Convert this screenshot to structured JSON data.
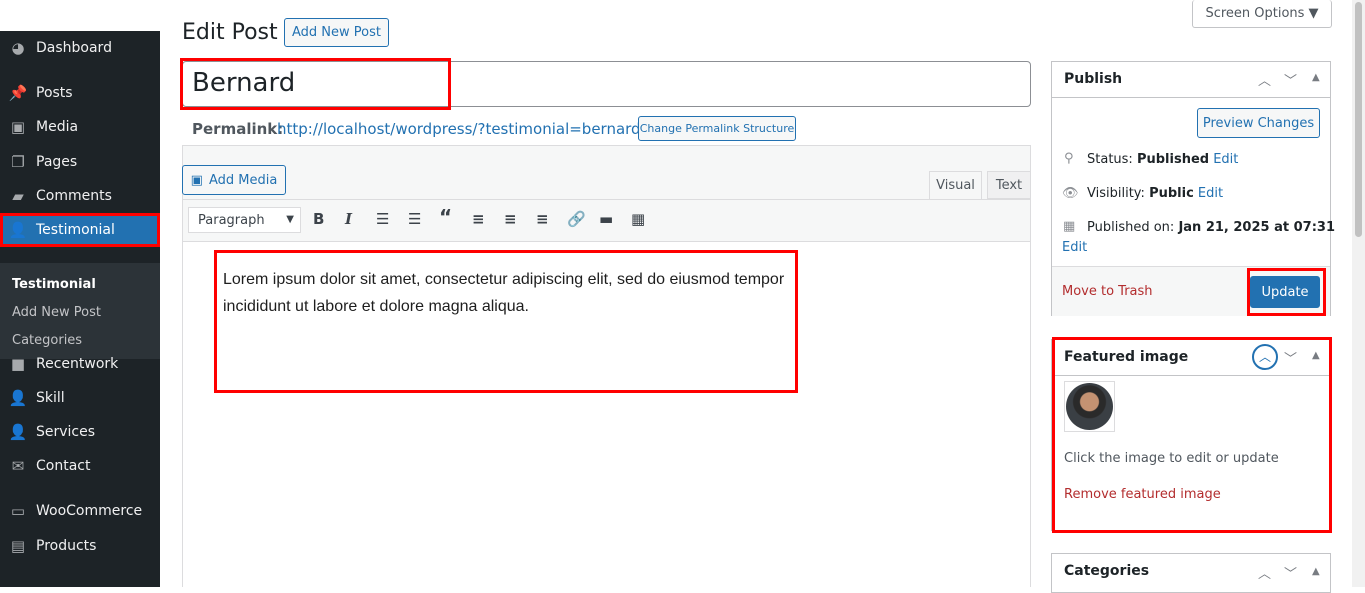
{
  "sidebar": {
    "items": [
      {
        "label": "Dashboard",
        "icon": "dashboard-icon"
      },
      {
        "label": "Posts",
        "icon": "pin-icon"
      },
      {
        "label": "Media",
        "icon": "media-icon"
      },
      {
        "label": "Pages",
        "icon": "pages-icon"
      },
      {
        "label": "Comments",
        "icon": "comment-icon"
      },
      {
        "label": "Testimonial",
        "icon": "user-icon"
      },
      {
        "label": "Recentwork",
        "icon": "video-icon"
      },
      {
        "label": "Skill",
        "icon": "user-icon"
      },
      {
        "label": "Services",
        "icon": "user-icon"
      },
      {
        "label": "Contact",
        "icon": "mail-icon"
      },
      {
        "label": "WooCommerce",
        "icon": "woo-icon"
      },
      {
        "label": "Products",
        "icon": "archive-icon"
      }
    ],
    "submenu": [
      "Testimonial",
      "Add New Post",
      "Categories"
    ]
  },
  "header": {
    "title": "Edit Post",
    "add_new": "Add New Post",
    "screen_options": "Screen Options ▼"
  },
  "post": {
    "title": "Bernard",
    "permalink_label": "Permalink:",
    "permalink": "http://localhost/wordpress/?testimonial=bernard",
    "change_permalink": "Change Permalink Structure"
  },
  "editor": {
    "add_media": "Add Media",
    "tab_visual": "Visual",
    "tab_text": "Text",
    "format": "Paragraph",
    "content_line1": "Lorem ipsum dolor sit amet, consectetur adipiscing elit, sed do eiusmod tempor",
    "content_line2": "incididunt ut labore et dolore magna aliqua."
  },
  "publish": {
    "title": "Publish",
    "preview": "Preview Changes",
    "status_label": "Status:",
    "status": "Published",
    "visibility_label": "Visibility:",
    "visibility": "Public",
    "published_label": "Published on:",
    "published": "Jan 21, 2025 at 07:31",
    "edit": "Edit",
    "trash": "Move to Trash",
    "update": "Update"
  },
  "featured": {
    "title": "Featured image",
    "hint": "Click the image to edit or update",
    "remove": "Remove featured image"
  },
  "categories": {
    "title": "Categories"
  }
}
